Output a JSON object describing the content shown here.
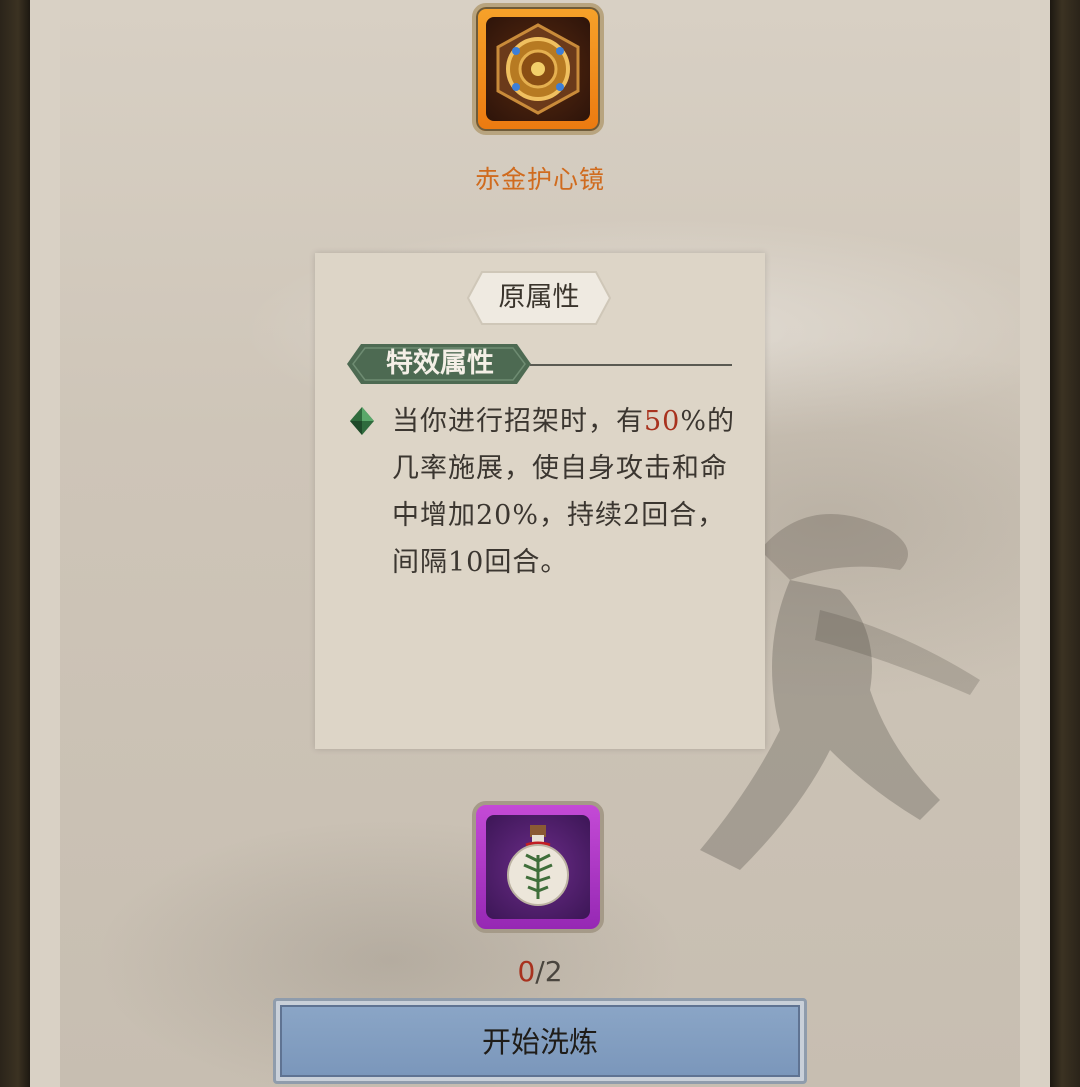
{
  "equipment": {
    "name": "赤金护心镜",
    "icon": "gold-heart-mirror-icon",
    "rarity_color": "#ec7a10"
  },
  "attribute_card": {
    "tab_label": "原属性",
    "section_title": "特效属性",
    "effect_lines": {
      "pre": "当你进行招架时，有",
      "chance": "50",
      "post": "%的几率施展，使自身攻击和命中增加20%，持续2回合，间隔10回合。"
    },
    "highlight_color": "#a8321e"
  },
  "material": {
    "icon": "refining-potion-icon",
    "rarity_color": "#9628b4",
    "count_current": "0",
    "count_separator": "/",
    "count_required": "2"
  },
  "actions": {
    "start_label": "开始洗炼"
  }
}
